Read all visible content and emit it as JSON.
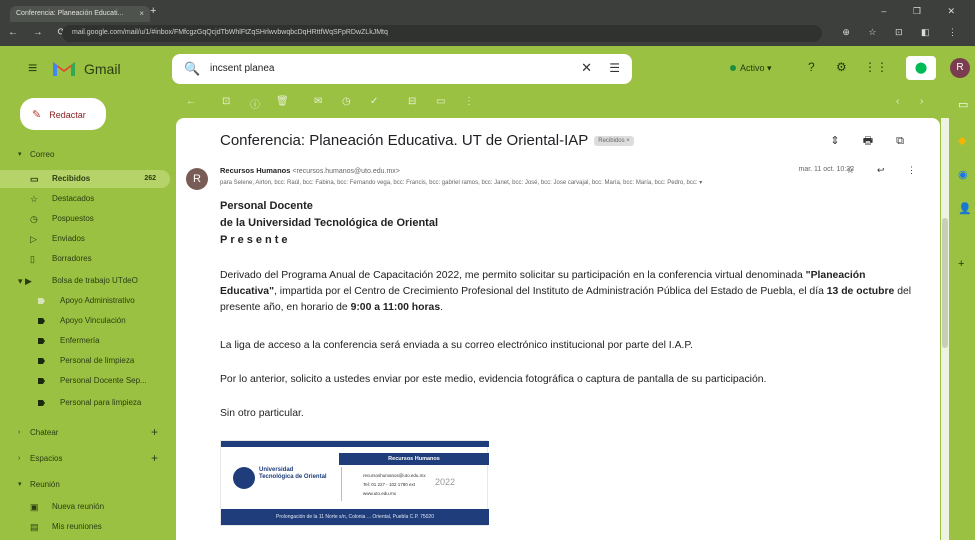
{
  "browser": {
    "tab_title": "Conferencia: Planeación Educati...",
    "tab_close": "×",
    "new_tab": "+",
    "window_controls": "‒ ❐ ✕",
    "nav": "← → ⟳",
    "url": "mail.google.com/mail/u/1/#inbox/FMfcgzGqQcjdTbWhlFtZqSHrlwvbwqbcDqHRttfWqSFpRDwZLkJMtq",
    "url_icons": "⊕ ☆ ⊡ ◧ ⋮"
  },
  "header": {
    "menu_icon": "≡",
    "app_name": "Gmail",
    "search_value": "incsent planea",
    "search_icon": "🔍",
    "clear_icon": "✕",
    "tune_icon": "☰",
    "status_label": "Activo ▾",
    "status_color": "#1e8e3e",
    "support_icon": "?",
    "settings_icon": "⚙",
    "apps_icon": "⋮⋮",
    "avatar_letter": "R"
  },
  "compose": {
    "label": "Redactar",
    "icon": "✎"
  },
  "sidebar": {
    "mail_section": "Correo",
    "items": [
      {
        "label": "Recibidos",
        "icon": "▭",
        "count": "262"
      },
      {
        "label": "Destacados",
        "icon": "☆"
      },
      {
        "label": "Pospuestos",
        "icon": "◷"
      },
      {
        "label": "Enviados",
        "icon": "▷"
      },
      {
        "label": "Borradores",
        "icon": "▯"
      }
    ],
    "group_label": "Bolsa de trabajo UTdeO",
    "sub_items": [
      "Apoyo Administrativo",
      "Apoyo Vinculación",
      "Enfermería",
      "Personal de limpieza",
      "Personal Docente Sep...",
      "Personal para limpieza"
    ],
    "chat_section": "Chatear",
    "spaces_section": "Espacios",
    "meet_section": "Reunión",
    "meet_items": [
      {
        "label": "Nueva reunión",
        "icon": "▣"
      },
      {
        "label": "Mis reuniones",
        "icon": "▤"
      }
    ]
  },
  "toolbar": {
    "back": "←",
    "archive": "⊡",
    "report": "ⓘ",
    "delete": "🗑",
    "unread": "✉",
    "snooze": "◷",
    "task": "✓",
    "move": "⊟",
    "label": "▭",
    "more": "⋮",
    "prev": "‹",
    "next": "›"
  },
  "email": {
    "subject": "Conferencia: Planeación Educativa. UT de Oriental-IAP",
    "label_badge": "Recibidos ×",
    "top_icons": "⇕ 🖶 ⧉",
    "sender_avatar": "R",
    "sender_name": "Recursos Humanos",
    "sender_email": "<recursos.humanos@uto.edu.mx>",
    "recipients": "para Selene, Airton, bcc: Raúl, bcc: Fabina, bcc: Fernando vega, bcc: Francis, bcc: gabriel ramos, bcc: Janet, bcc: José, bcc: Jose carvajal, bcc: María, bcc: María, bcc: Pedro, bcc: ▾",
    "date": "mar. 11 oct. 10:32",
    "msg_icons": "☆ ↩ ⋮",
    "greeting": [
      "Personal Docente",
      "de la Universidad Tecnológica de Oriental",
      "Presente"
    ],
    "p1_a": "Derivado del Programa Anual de Capacitación 2022, me permito solicitar su participación en la conferencia virtual denominada ",
    "p1_b": "\"Planeación Educativa\"",
    "p1_c": ", impartida por el Centro de Crecimiento Profesional del Instituto de Administración Pública del Estado de Puebla, el día ",
    "p1_d": "13 de octubre",
    "p1_e": " del presente año, en horario de ",
    "p1_f": "9:00 a 11:00 horas",
    "p1_g": ".",
    "p2": "La liga de acceso a la conferencia será enviada a su correo electrónico institucional por parte del I.A.P.",
    "p3": "Por lo anterior, solicito a ustedes enviar por este medio, evidencia fotográfica o captura de pantalla de su participación.",
    "p4": "Sin otro particular.",
    "signature": {
      "dept": "Recursos Humanos",
      "university": "Universidad Tecnológica de Oriental",
      "contact_lines": [
        "recursoshumanos@uto.edu.mx",
        "Tel: 01 227 - 102 1780 ext",
        "www.uto.edu.mx"
      ],
      "year": "2022",
      "address": "Prolongación de la 11 Norte s/n, Colonia ... Oriental, Puebla C.P. 75020"
    }
  },
  "right_rail": [
    "▭",
    "◆",
    "◉",
    "👤",
    "+"
  ]
}
